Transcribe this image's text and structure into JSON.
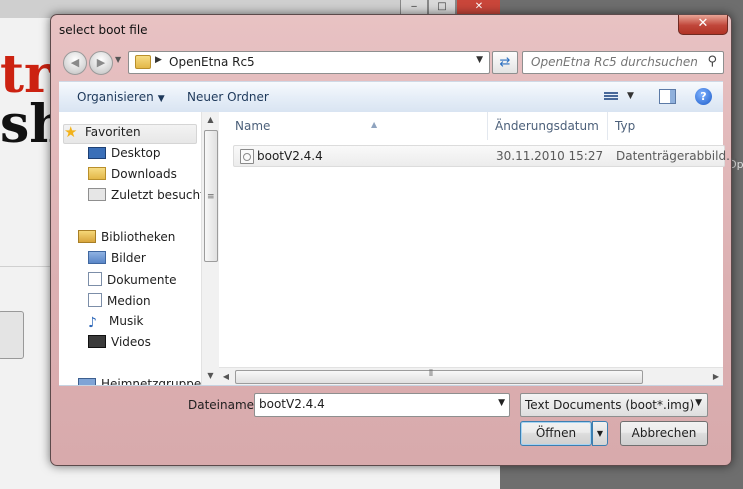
{
  "background_app": {
    "logo_part1": "tr",
    "logo_part2": "sh",
    "right_text": "Op",
    "window_buttons": [
      "‒",
      "□",
      "✕"
    ]
  },
  "dialog": {
    "title": "select boot file",
    "close_glyph": "✕"
  },
  "navigation": {
    "breadcrumb": "OpenEtna Rc5",
    "search_placeholder": "OpenEtna Rc5 durchsuchen"
  },
  "toolbar": {
    "organize_label": "Organisieren",
    "new_folder_label": "Neuer Ordner",
    "help_glyph": "?"
  },
  "nav_pane": {
    "items": [
      {
        "label": "Favoriten",
        "icon": "star-icon"
      },
      {
        "label": "Desktop",
        "icon": "desktop-icon"
      },
      {
        "label": "Downloads",
        "icon": "downloads-folder-icon"
      },
      {
        "label": "Zuletzt besucht",
        "icon": "recent-places-icon"
      },
      {
        "label": "Bibliotheken",
        "icon": "libraries-icon"
      },
      {
        "label": "Bilder",
        "icon": "pictures-icon"
      },
      {
        "label": "Dokumente",
        "icon": "documents-icon"
      },
      {
        "label": "Medion",
        "icon": "documents-icon"
      },
      {
        "label": "Musik",
        "icon": "music-note-icon"
      },
      {
        "label": "Videos",
        "icon": "video-film-icon"
      },
      {
        "label": "Heimnetzgruppe",
        "icon": "homegroup-icon"
      }
    ]
  },
  "file_list": {
    "columns": [
      "Name",
      "Änderungsdatum",
      "Typ"
    ],
    "rows": [
      {
        "name": "bootV2.4.4",
        "date": "30.11.2010 15:27",
        "type": "Datenträgerabbild..."
      }
    ]
  },
  "form": {
    "filename_label": "Dateiname:",
    "filename_value": "bootV2.4.4",
    "filetype_value": "Text Documents (boot*.img)",
    "open_label": "Öffnen",
    "cancel_label": "Abbrechen"
  }
}
